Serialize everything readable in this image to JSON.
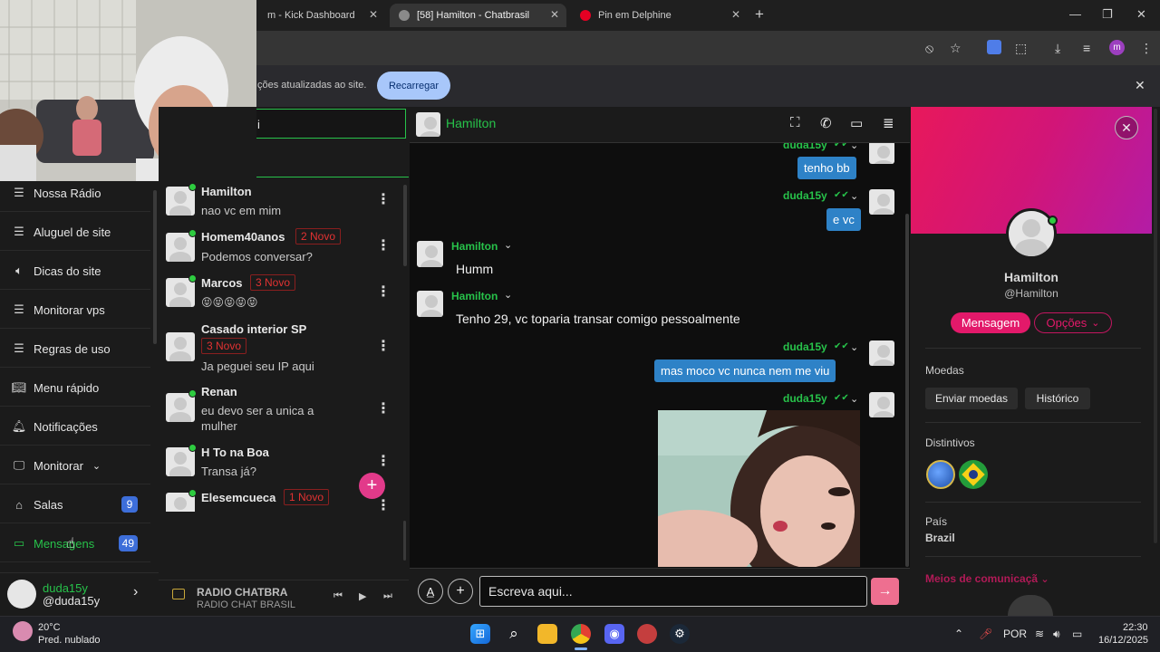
{
  "browser": {
    "tabs": [
      {
        "label": "m - Kick Dashboard"
      },
      {
        "label": "[58] Hamilton - Chatbrasil"
      },
      {
        "label": "Pin em Delphine"
      }
    ],
    "infobar_text": "ções atualizadas ao site.",
    "reload_label": "Recarregar",
    "profile_initial": "m"
  },
  "nav": {
    "items": [
      {
        "label": "Nossa Rádio",
        "icon": "list-icon"
      },
      {
        "label": "Aluguel de site",
        "icon": "list-icon"
      },
      {
        "label": "Dicas do site",
        "icon": "speaker-icon"
      },
      {
        "label": "Monitorar vps",
        "icon": "list-icon"
      },
      {
        "label": "Regras de uso",
        "icon": "list-icon"
      },
      {
        "label": "Menu rápido",
        "icon": "book-icon"
      },
      {
        "label": "Notificações",
        "icon": "bell-icon"
      },
      {
        "label": "Monitorar",
        "icon": "monitor-icon"
      },
      {
        "label": "Salas",
        "icon": "rooms-icon",
        "badge": "9"
      },
      {
        "label": "Mensagens",
        "icon": "chat-icon",
        "badge": "49"
      }
    ]
  },
  "user": {
    "display": "duda15y",
    "handle": "@duda15y"
  },
  "conversations": [
    {
      "name": "Hamilton",
      "message": "nao vc em mim",
      "badge": ""
    },
    {
      "name": "Homem40anos",
      "message": "Podemos conversar?",
      "badge": "2 Novo"
    },
    {
      "name": "Marcos",
      "message": "😝😝😝😝😝",
      "badge": "3 Novo"
    },
    {
      "name": "Casado interior SP",
      "message": "Ja peguei seu IP aqui",
      "badge": "3 Novo"
    },
    {
      "name": "Renan",
      "message": "eu devo ser a unica a mulher",
      "badge": ""
    },
    {
      "name": "H To na Boa",
      "message": "Transa já?",
      "badge": ""
    },
    {
      "name": "Elesemcueca",
      "message": "",
      "badge": "1 Novo"
    }
  ],
  "radio": {
    "title": "RADIO CHATBRA",
    "subtitle": "RADIO CHAT BRASIL"
  },
  "chat": {
    "contact": "Hamilton",
    "messages": [
      {
        "from": "duda15y",
        "text": "tenho bb",
        "dir": "out"
      },
      {
        "from": "duda15y",
        "text": "e vc",
        "dir": "out"
      },
      {
        "from": "Hamilton",
        "text": "Humm",
        "dir": "in"
      },
      {
        "from": "Hamilton",
        "text": "Tenho 29, vc toparia transar comigo pessoalmente",
        "dir": "in"
      },
      {
        "from": "duda15y",
        "text": "mas moco vc nunca nem me viu",
        "dir": "out"
      },
      {
        "from": "duda15y",
        "text": "",
        "dir": "out-image"
      }
    ],
    "input_placeholder": "Escreva aqui..."
  },
  "profile": {
    "name": "Hamilton",
    "handle": "@Hamilton",
    "message_button": "Mensagem",
    "options_button": "Opções",
    "coins_title": "Moedas",
    "send_coins": "Enviar moedas",
    "history": "Histórico",
    "badges_title": "Distintivos",
    "country_label": "País",
    "country_value": "Brazil",
    "contact_means": "Meios de comunicaçã"
  },
  "taskbar": {
    "weather_temp": "20°C",
    "weather_desc": "Pred. nublado",
    "lang": "POR",
    "time": "22:30",
    "date": "16/12/2025"
  },
  "colors": {
    "accent_green": "#27c24a",
    "pink": "#e23a8a",
    "bubble_blue": "#2e82c7",
    "badge_blue": "#3d6ed9",
    "new_red": "#e23232"
  }
}
